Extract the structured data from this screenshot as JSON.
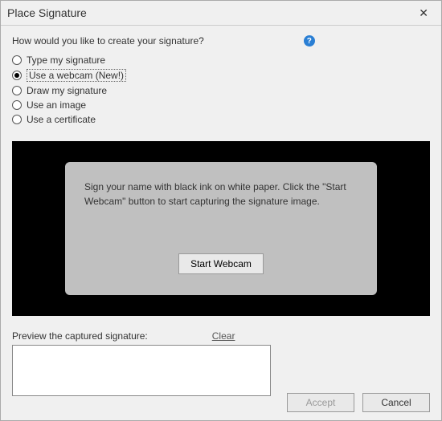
{
  "title": "Place Signature",
  "close_glyph": "✕",
  "question": "How would you like to create your signature?",
  "help_glyph": "?",
  "options": [
    {
      "label": "Type my signature",
      "checked": false
    },
    {
      "label": "Use a webcam (New!)",
      "checked": true
    },
    {
      "label": "Draw my signature",
      "checked": false
    },
    {
      "label": "Use an image",
      "checked": false
    },
    {
      "label": "Use a certificate",
      "checked": false
    }
  ],
  "webcam": {
    "instructions": "Sign your name with black ink on white paper. Click the \"Start Webcam\" button to start capturing the signature image.",
    "start_button": "Start Webcam"
  },
  "preview_caption": "Preview the captured signature:",
  "clear_label": "Clear",
  "buttons": {
    "accept": "Accept",
    "cancel": "Cancel"
  }
}
